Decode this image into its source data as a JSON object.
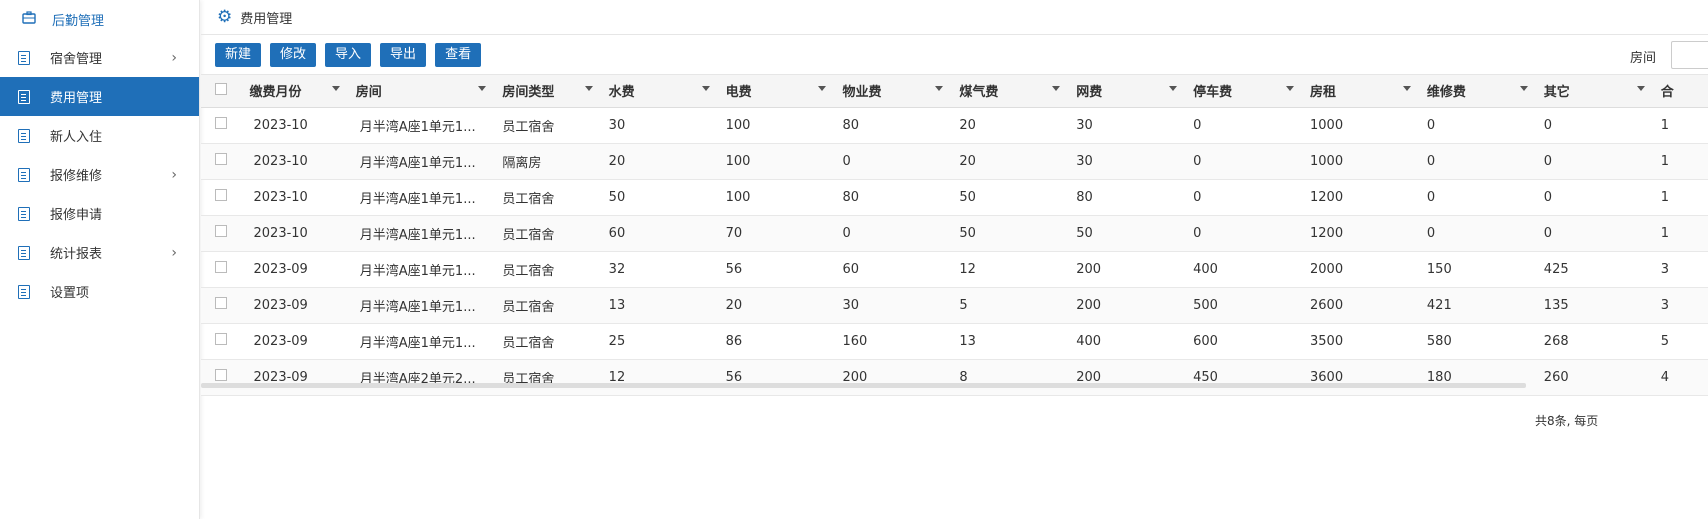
{
  "sidebar": {
    "header": "后勤管理",
    "items": [
      {
        "label": "宿舍管理",
        "chevron": true,
        "active": false
      },
      {
        "label": "费用管理",
        "chevron": false,
        "active": true
      },
      {
        "label": "新人入住",
        "chevron": false,
        "active": false
      },
      {
        "label": "报修维修",
        "chevron": true,
        "active": false
      },
      {
        "label": "报修申请",
        "chevron": false,
        "active": false
      },
      {
        "label": "统计报表",
        "chevron": true,
        "active": false
      },
      {
        "label": "设置项",
        "chevron": false,
        "active": false
      }
    ]
  },
  "page": {
    "title": "费用管理"
  },
  "toolbar": {
    "buttons": [
      "新建",
      "修改",
      "导入",
      "导出",
      "查看"
    ],
    "filter_label": "房间",
    "filter_value": ""
  },
  "table": {
    "columns": [
      "缴费月份",
      "房间",
      "房间类型",
      "水费",
      "电费",
      "物业费",
      "煤气费",
      "网费",
      "停车费",
      "房租",
      "维修费",
      "其它",
      "合"
    ],
    "rows": [
      [
        "2023-10",
        "月半湾A座1单元1...",
        "员工宿舍",
        "30",
        "100",
        "80",
        "20",
        "30",
        "0",
        "1000",
        "0",
        "0",
        "1"
      ],
      [
        "2023-10",
        "月半湾A座1单元1...",
        "隔离房",
        "20",
        "100",
        "0",
        "20",
        "30",
        "0",
        "1000",
        "0",
        "0",
        "1"
      ],
      [
        "2023-10",
        "月半湾A座1单元1...",
        "员工宿舍",
        "50",
        "100",
        "80",
        "50",
        "80",
        "0",
        "1200",
        "0",
        "0",
        "1"
      ],
      [
        "2023-10",
        "月半湾A座1单元1...",
        "员工宿舍",
        "60",
        "70",
        "0",
        "50",
        "50",
        "0",
        "1200",
        "0",
        "0",
        "1"
      ],
      [
        "2023-09",
        "月半湾A座1单元1...",
        "员工宿舍",
        "32",
        "56",
        "60",
        "12",
        "200",
        "400",
        "2000",
        "150",
        "425",
        "3"
      ],
      [
        "2023-09",
        "月半湾A座1单元1...",
        "员工宿舍",
        "13",
        "20",
        "30",
        "5",
        "200",
        "500",
        "2600",
        "421",
        "135",
        "3"
      ],
      [
        "2023-09",
        "月半湾A座1单元1...",
        "员工宿舍",
        "25",
        "86",
        "160",
        "13",
        "400",
        "600",
        "3500",
        "580",
        "268",
        "5"
      ],
      [
        "2023-09",
        "月半湾A座2单元2...",
        "员工宿舍",
        "12",
        "56",
        "200",
        "8",
        "200",
        "450",
        "3600",
        "180",
        "260",
        "4"
      ]
    ]
  },
  "pager": {
    "text": "共8条, 每页"
  },
  "colors": {
    "accent": "#1f6fb8"
  }
}
